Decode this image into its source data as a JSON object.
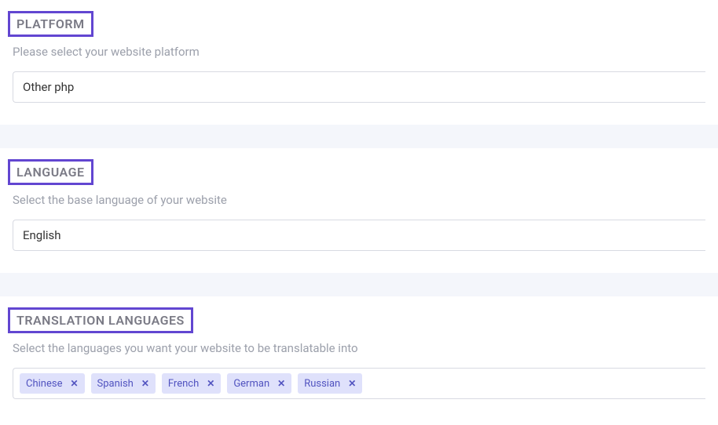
{
  "platform": {
    "title": "PLATFORM",
    "subtitle": "Please select your website platform",
    "selected": "Other php"
  },
  "language": {
    "title": "LANGUAGE",
    "subtitle": "Select the base language of your website",
    "selected": "English"
  },
  "translation": {
    "title": "TRANSLATION LANGUAGES",
    "subtitle": "Select the languages you want your website to be translatable into",
    "tags": [
      "Chinese",
      "Spanish",
      "French",
      "German",
      "Russian"
    ]
  }
}
